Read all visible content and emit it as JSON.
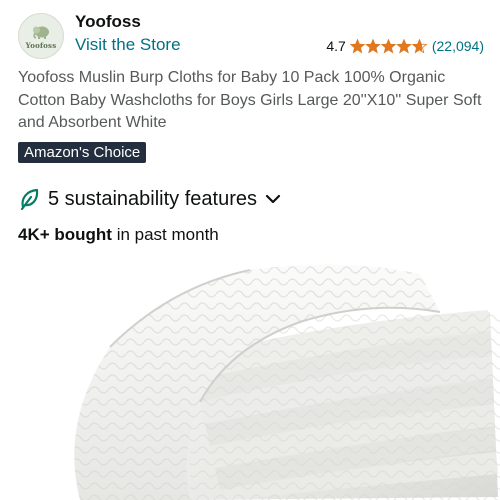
{
  "store": {
    "brand_name": "Yoofoss",
    "logo_text": "Yoofoss",
    "visit_link": "Visit the Store"
  },
  "rating": {
    "value": "4.7",
    "stars": 4.7,
    "count": "(22,094)"
  },
  "product": {
    "title": "Yoofoss Muslin Burp Cloths for Baby 10 Pack 100% Organic Cotton Baby Washcloths for Boys Girls Large 20''X10'' Super Soft and Absorbent White"
  },
  "badge": {
    "label": "Amazon's Choice"
  },
  "sustainability": {
    "label": "5 sustainability features",
    "icon": "leaf-icon"
  },
  "bought": {
    "bold": "4K+ bought",
    "rest": " in past month"
  },
  "colors": {
    "link": "#007185",
    "star": "#de7921",
    "badge_bg": "#232f3e",
    "leaf": "#067d62"
  }
}
